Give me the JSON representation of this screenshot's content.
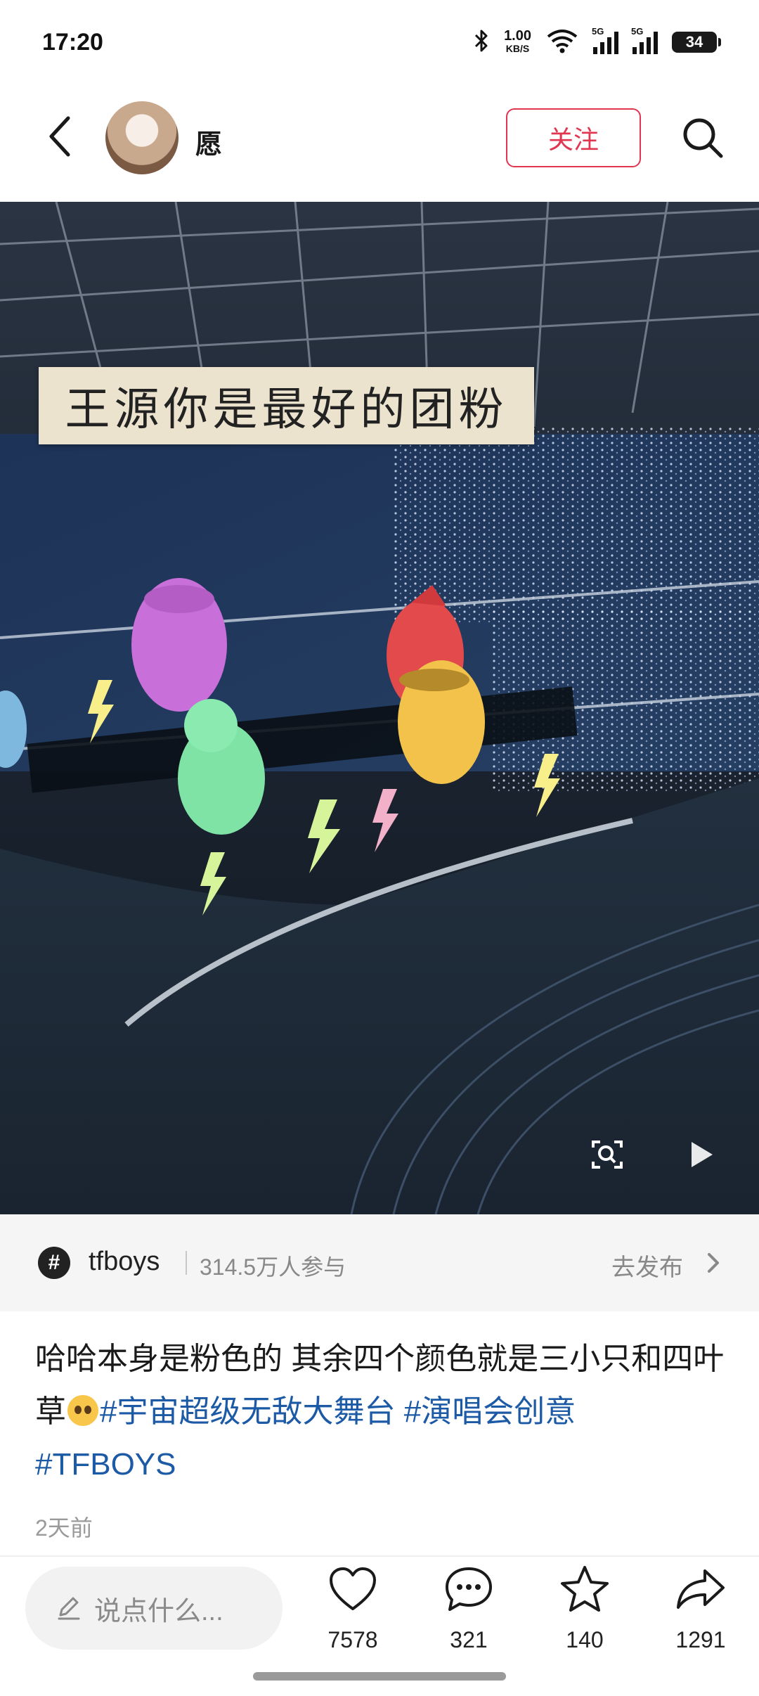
{
  "status_bar": {
    "time": "17:20",
    "net_speed_value": "1.00",
    "net_speed_unit": "KB/S",
    "signal_1_label": "5G",
    "signal_2_label": "5G",
    "battery_level": "34",
    "icons": [
      "bluetooth-icon",
      "wifi-icon",
      "signal-icon",
      "signal-icon",
      "battery-icon"
    ]
  },
  "header": {
    "back_icon": "chevron-left-icon",
    "username": "愿",
    "follow_label": "关注",
    "search_icon": "search-icon"
  },
  "media": {
    "overlay_text": "王源你是最好的团粉",
    "controls": [
      "visual-search-icon",
      "play-icon"
    ]
  },
  "topic": {
    "icon_glyph": "#",
    "name": "tfboys",
    "participants": "314.5万人参与",
    "go_publish": "去发布"
  },
  "post": {
    "text_main": "哈哈本身是粉色的 其余四个颜色就是三小只和四叶草",
    "emoji": "pleading-face",
    "hashtags": [
      "#宇宙超级无敌大舞台",
      "#演唱会创意",
      "#TFBOYS"
    ],
    "time": "2天前"
  },
  "actions": {
    "comment_placeholder": "说点什么...",
    "likes": "7578",
    "comments": "321",
    "favorites": "140",
    "shares": "1291"
  },
  "colors": {
    "accent": "#e0364f",
    "hashtag": "#1c5aa6",
    "topic_bg": "#f5f5f5"
  }
}
